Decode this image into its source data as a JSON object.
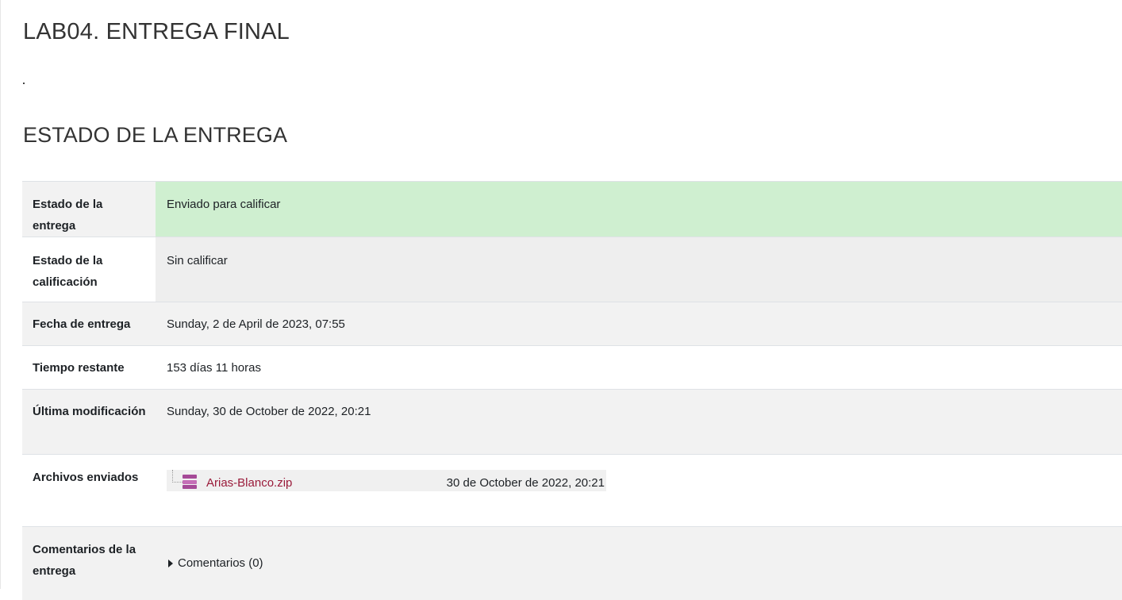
{
  "page": {
    "title": "LAB04. ENTREGA FINAL",
    "section_title": "ESTADO DE LA ENTREGA"
  },
  "status_table": {
    "rows": [
      {
        "label": "Estado de la entrega",
        "value": "Enviado para calificar"
      },
      {
        "label": "Estado de la calificación",
        "value": "Sin calificar"
      },
      {
        "label": "Fecha de entrega",
        "value": "Sunday, 2 de April de 2023, 07:55"
      },
      {
        "label": "Tiempo restante",
        "value": "153 días 11 horas"
      },
      {
        "label": "Última modificación",
        "value": "Sunday, 30 de October de 2022, 20:21"
      },
      {
        "label": "Archivos enviados",
        "value": ""
      },
      {
        "label": "Comentarios de la entrega",
        "value": ""
      }
    ]
  },
  "submitted_file": {
    "name": "Arias-Blanco.zip",
    "date": "30 de October de 2022, 20:21",
    "icon": "zip-archive-icon"
  },
  "comments": {
    "label": "Comentarios (0)",
    "icon": "caret-right-icon"
  },
  "colors": {
    "submitted_status_bg": "#cfefd0",
    "link": "#9a1b3a",
    "zip_icon": "#a54a97"
  }
}
